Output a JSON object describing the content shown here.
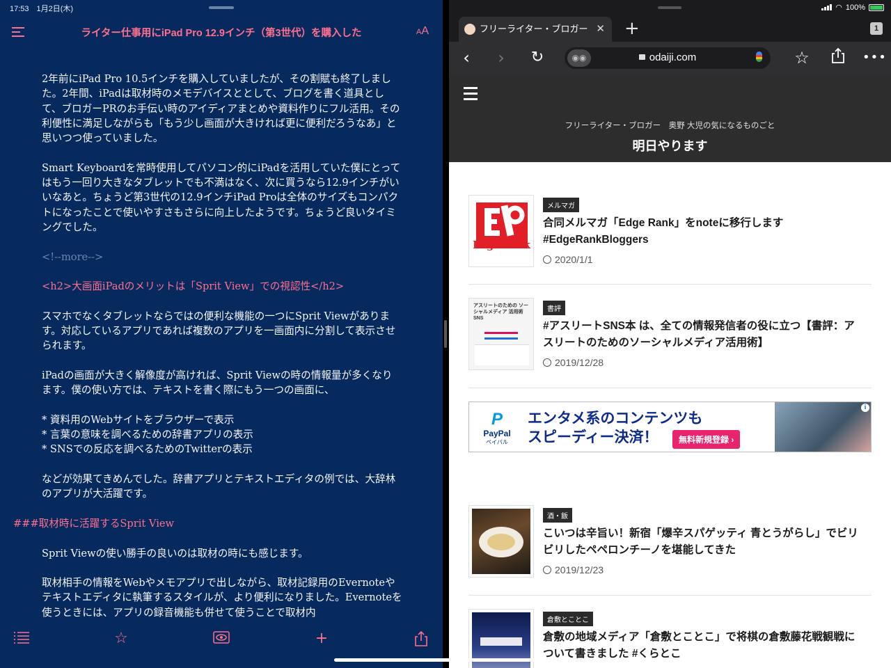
{
  "left": {
    "status": "17:53　1月2日(木)",
    "title": "ライター仕事用にiPad Pro 12.9インチ（第3世代）を購入した",
    "font_button": "AA",
    "paragraphs": [
      "2年前にiPad Pro 10.5インチを購入していましたが、その割賦も終了しました。2年間、iPadは取材時のメモデバイスととして、ブログを書く道具として、ブロガーPRのお手伝い時のアイディアまとめや資料作りにフル活用。その利便性に満足しながらも「もう少し画面が大きければ更に便利だろうなあ」と思いつつ使っていました。",
      "Smart Keyboardを常時使用してパソコン的にiPadを活用していた僕にとってはもう一回り大きなタブレットでも不満はなく、次に買うなら12.9インチがいいなあと。ちょうど第3世代の12.9インチiPad Proは全体のサイズもコンパクトになったことで使いやすさもさらに向上したようです。ちょうど良いタイミングでした。"
    ],
    "more_tag": "<!--more-->",
    "h2": "<h2>大画面iPadのメリットは「Sprit View」での視認性</h2>",
    "paragraphs2": [
      "スマホでなくタブレットならではの便利な機能の一つにSprit Viewがあります。対応しているアプリであれば複数のアプリを一画面内に分割して表示させられます。",
      "iPadの画面が大きく解像度が高ければ、Sprit Viewの時の情報量が多くなります。僕の使い方では、テキストを書く際にもう一つの画面に、"
    ],
    "list": [
      "* 資料用のWebサイトをブラウザーで表示",
      "* 言葉の意味を調べるための辞書アプリの表示",
      "* SNSでの反応を調べるためのTwitterの表示"
    ],
    "paragraph3": "などが効果てきめんでした。辞書アプリとテキストエディタの例では、大辞林のアプリが大活躍です。",
    "h3": "###取材時に活躍するSprit View",
    "paragraphs4": [
      "Sprit Viewの使い勝手の良いのは取材の時にも感じます。",
      "取材相手の情報をWebやメモアプリで出しながら、取材記録用のEvernoteやテキストエディタに執筆するスタイルが、より便利になりました。Evernoteを使うときには、アプリの録音機能も併せて使うことで取材内"
    ]
  },
  "browser": {
    "status": "100%",
    "tab_title": "フリーライター・ブロガー",
    "tab_count": "1",
    "url": "odaiji.com",
    "site_tagline": "フリーライター・ブロガー　奥野 大児の気になるものごと",
    "site_name": "明日やります",
    "articles": [
      {
        "category": "メルマガ",
        "title": "合同メルマガ「Edge Rank」をnoteに移行します #EdgeRankBloggers",
        "date": "2020/1/1",
        "thumb_text": "Edge Rank"
      },
      {
        "category": "書評",
        "title": "#アスリートSNS本 は、全ての情報発信者の役に立つ【書評：アスリートのためのソーシャルメディア活用術】",
        "date": "2019/12/28",
        "thumb_text": "アスリートのための ソーシャルメディア 活用術 SNS"
      },
      {
        "category": "酒・飯",
        "title": "こいつは辛旨い！新宿「爆辛スパゲッティ 青とうがらし」でビリビリしたペペロンチーノを堪能してきた",
        "date": "2019/12/23",
        "thumb_text": ""
      },
      {
        "category": "倉敷とことこ",
        "title": "倉敷の地域メディア「倉敷とことこ」で将棋の倉敷藤花戦観戦について書きました #くらとこ",
        "date": "",
        "thumb_text": ""
      }
    ],
    "ad": {
      "brand": "PayPal",
      "brand_sub": "ペイパル",
      "line1": "エンタメ系のコンテンツも",
      "line2": "スピーディー決済！",
      "cta": "無料新規登録 ›"
    }
  }
}
